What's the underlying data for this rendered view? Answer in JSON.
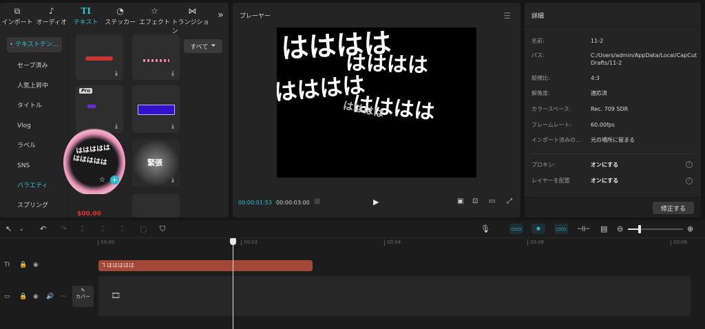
{
  "media_tabs": [
    {
      "icon": "import-icon",
      "glyph": "⧉",
      "label": "インポート"
    },
    {
      "icon": "audio-icon",
      "glyph": "♪",
      "label": "オーディオ"
    },
    {
      "icon": "text-icon",
      "glyph": "TI",
      "label": "テキスト",
      "active": true
    },
    {
      "icon": "sticker-icon",
      "glyph": "◔",
      "label": "ステッカー"
    },
    {
      "icon": "effect-icon",
      "glyph": "☆",
      "label": "エフェクト"
    },
    {
      "icon": "transition-icon",
      "glyph": "⋈",
      "label": "トランジション"
    }
  ],
  "subnav": {
    "selected": "• テキストテン…",
    "items": [
      "セーブ済み",
      "人気上昇中",
      "タイトル",
      "Vlog",
      "ラベル",
      "SNS",
      "バラエティ",
      "スプリング"
    ]
  },
  "filter": {
    "label": "すべて"
  },
  "templates": {
    "pro_badge": "Pro",
    "kincho": "緊張",
    "hahaha_small": "ははははは",
    "partial_red": "$00.00"
  },
  "player": {
    "title": "プレーヤー",
    "current_time": "00:00:01:53",
    "total_time": "00:00:03:00",
    "video_text": "はははは"
  },
  "details": {
    "title": "詳細",
    "rows": [
      {
        "k": "名前:",
        "v": "11-2"
      },
      {
        "k": "パス:",
        "v": "C:/Users/admin/AppData/Local/CapCut Drafts/11-2"
      },
      {
        "k": "縦横比:",
        "v": "4:3"
      },
      {
        "k": "解像度:",
        "v": "適応済"
      },
      {
        "k": "カラースペース:",
        "v": "Rec. 709 SDR"
      },
      {
        "k": "フレームレート:",
        "v": "60.00fps"
      },
      {
        "k": "インポート済みの…",
        "v": "元の場所に留まる"
      }
    ],
    "proxy": {
      "k": "プロキシ:",
      "v": "オンにする"
    },
    "layer": {
      "k": "レイヤーを配置",
      "v": "オンにする"
    },
    "fix_button": "修正する"
  },
  "timeline": {
    "ruler": [
      "00:00",
      "00:02",
      "00:04",
      "00:06",
      "00:08"
    ],
    "text_clip": "ははははは",
    "cover_label": "カバー",
    "zoom_level": 0.2
  }
}
